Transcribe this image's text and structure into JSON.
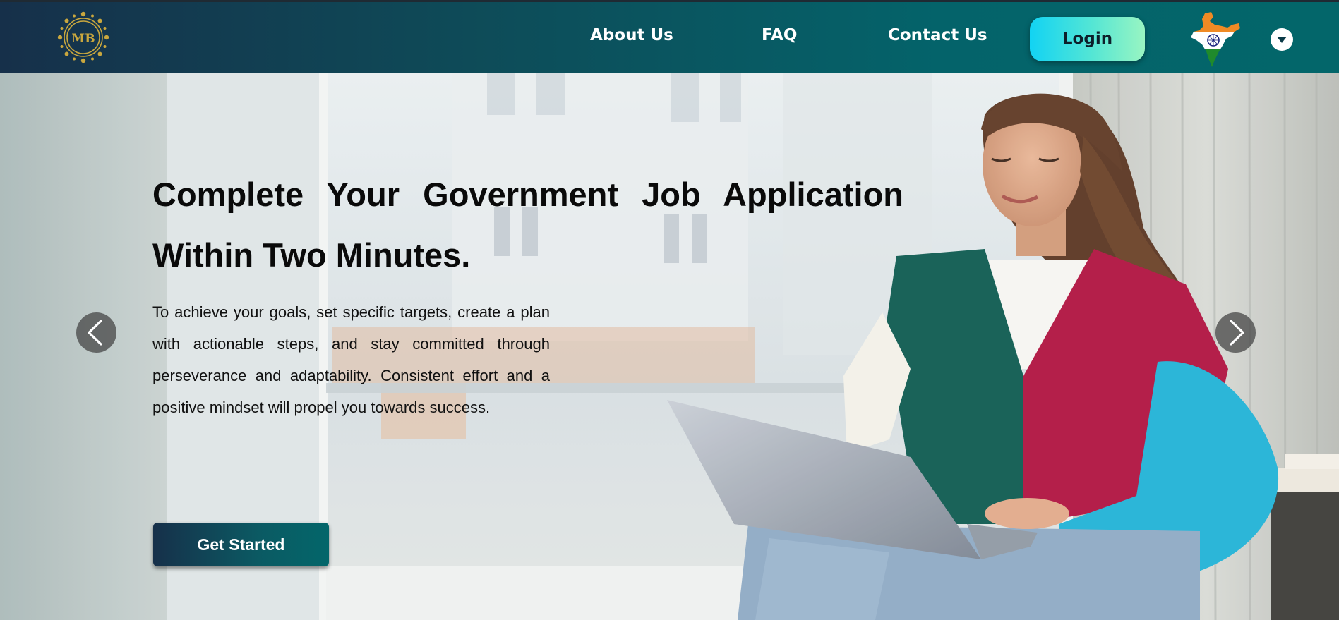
{
  "header": {
    "logo_text": "MB",
    "nav": {
      "about": "About Us",
      "faq": "FAQ",
      "contact": "Contact Us"
    },
    "login_label": "Login"
  },
  "hero": {
    "title": "Complete Your Government Job Application Within Two Minutes.",
    "body": "To achieve your goals, set specific targets, create a plan with actionable steps, and stay committed through perseverance and adaptability. Consistent effort and a positive mindset will propel you towards success.",
    "cta_label": "Get Started"
  },
  "icons": {
    "logo": "mb-emblem-icon",
    "country": "india-flag-map-icon",
    "dropdown": "caret-down-icon",
    "prev": "chevron-left-icon",
    "next": "chevron-right-icon"
  },
  "colors": {
    "nav_start": "#16304a",
    "nav_end": "#03666a",
    "login_start": "#12d3f3",
    "login_end": "#99f5c2",
    "logo_gold": "#c9a73e"
  }
}
